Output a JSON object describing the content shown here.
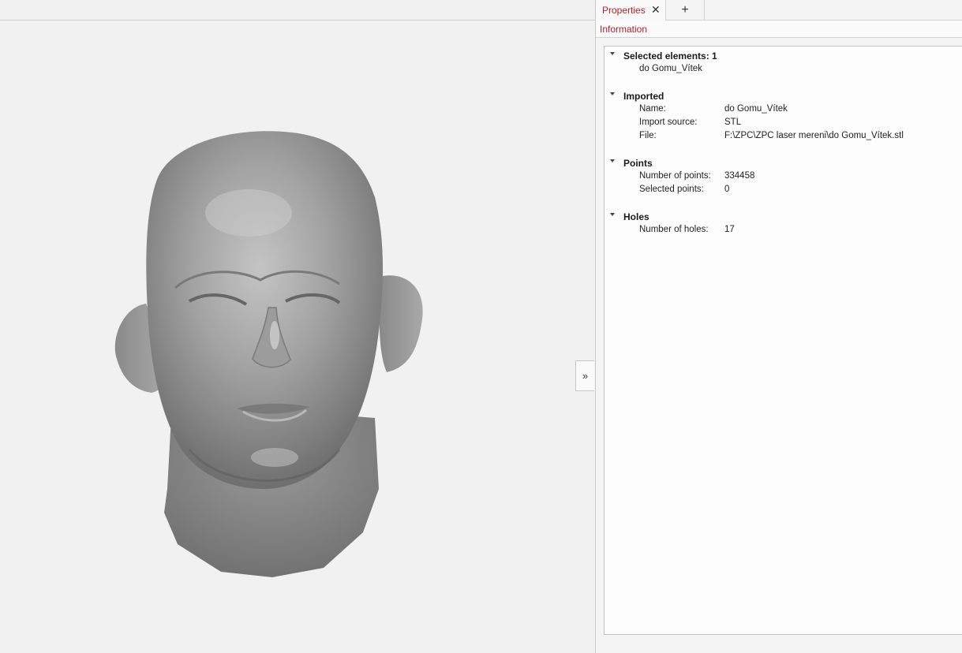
{
  "panel": {
    "tab_label": "Properties",
    "tab_close": "✕",
    "tab_add": "+",
    "subtab_label": "Information",
    "collapse_label": "»"
  },
  "groups": {
    "selected": {
      "title": "Selected elements:",
      "count": "1",
      "item": "do Gomu_Vítek"
    },
    "imported": {
      "title": "Imported",
      "rows": [
        {
          "label": "Name:",
          "value": "do Gomu_Vítek"
        },
        {
          "label": "Import source:",
          "value": "STL"
        },
        {
          "label": "File:",
          "value": "F:\\ZPC\\ZPC laser mereni\\do Gomu_Vítek.stl"
        }
      ]
    },
    "points": {
      "title": "Points",
      "rows": [
        {
          "label": "Number of points:",
          "value": "334458"
        },
        {
          "label": "Selected points:",
          "value": "0"
        }
      ]
    },
    "holes": {
      "title": "Holes",
      "rows": [
        {
          "label": "Number of holes:",
          "value": "17"
        }
      ]
    }
  },
  "colors": {
    "accent": "#b0202a",
    "model": "#8f8f8f",
    "background": "#f1f1f1"
  }
}
